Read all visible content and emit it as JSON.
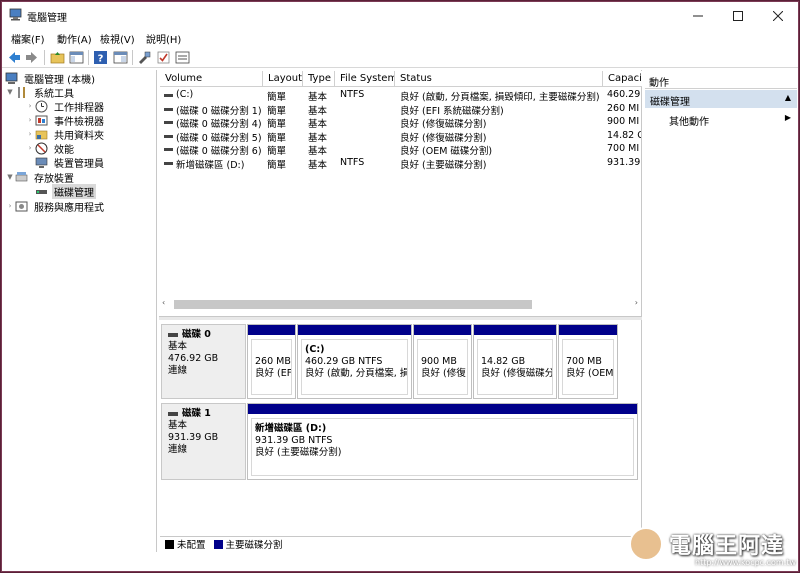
{
  "window": {
    "title": "電腦管理"
  },
  "menu": [
    "檔案(F)",
    "動作(A)",
    "檢視(V)",
    "說明(H)"
  ],
  "tree": {
    "root": "電腦管理 (本機)",
    "system_tools": "系統工具",
    "task_scheduler": "工作排程器",
    "event_viewer": "事件檢視器",
    "shared_folders": "共用資料夾",
    "performance": "效能",
    "device_manager": "裝置管理員",
    "storage": "存放裝置",
    "disk_management": "磁碟管理",
    "services": "服務與應用程式"
  },
  "volume_table": {
    "headers": [
      "Volume",
      "Layout",
      "Type",
      "File System",
      "Status",
      "Capaci"
    ],
    "rows": [
      [
        "(C:)",
        "簡單",
        "基本",
        "NTFS",
        "良好 (啟動, 分頁檔案, 損毀傾印, 主要磁碟分割)",
        "460.29"
      ],
      [
        "(磁碟 0 磁碟分割 1)",
        "簡單",
        "基本",
        "",
        "良好 (EFI 系統磁碟分割)",
        "260 MI"
      ],
      [
        "(磁碟 0 磁碟分割 4)",
        "簡單",
        "基本",
        "",
        "良好 (修復磁碟分割)",
        "900 MI"
      ],
      [
        "(磁碟 0 磁碟分割 5)",
        "簡單",
        "基本",
        "",
        "良好 (修復磁碟分割)",
        "14.82 C"
      ],
      [
        "(磁碟 0 磁碟分割 6)",
        "簡單",
        "基本",
        "",
        "良好 (OEM 磁碟分割)",
        "700 MI"
      ],
      [
        "新增磁碟區 (D:)",
        "簡單",
        "基本",
        "NTFS",
        "良好 (主要磁碟分割)",
        "931.39"
      ]
    ]
  },
  "disks": [
    {
      "name": "磁碟 0",
      "type": "基本",
      "size": "476.92 GB",
      "status": "連線",
      "partitions": [
        {
          "name": "",
          "size": "260 MB",
          "status": "良好 (EFI"
        },
        {
          "name": "(C:)",
          "size": "460.29 GB NTFS",
          "status": "良好 (啟動, 分頁檔案, 損"
        },
        {
          "name": "",
          "size": "900 MB",
          "status": "良好 (修復​"
        },
        {
          "name": "",
          "size": "14.82 GB",
          "status": "良好 (修復磁碟分"
        },
        {
          "name": "",
          "size": "700 MB",
          "status": "良好 (OEM"
        }
      ]
    },
    {
      "name": "磁碟 1",
      "type": "基本",
      "size": "931.39 GB",
      "status": "連線",
      "partitions": [
        {
          "name": "新增磁碟區  (D:)",
          "size": "931.39 GB NTFS",
          "status": "良好 (主要磁碟分割)"
        }
      ]
    }
  ],
  "legend": {
    "unallocated": "未配置",
    "primary": "主要磁碟分割",
    "unallocated_color": "#000000",
    "primary_color": "#00008a"
  },
  "actions": {
    "header": "動作",
    "section": "磁碟管理",
    "more": "其他動作"
  },
  "watermark": {
    "text": "電腦王阿達",
    "url": "http://www.kocpc.com.tw"
  }
}
